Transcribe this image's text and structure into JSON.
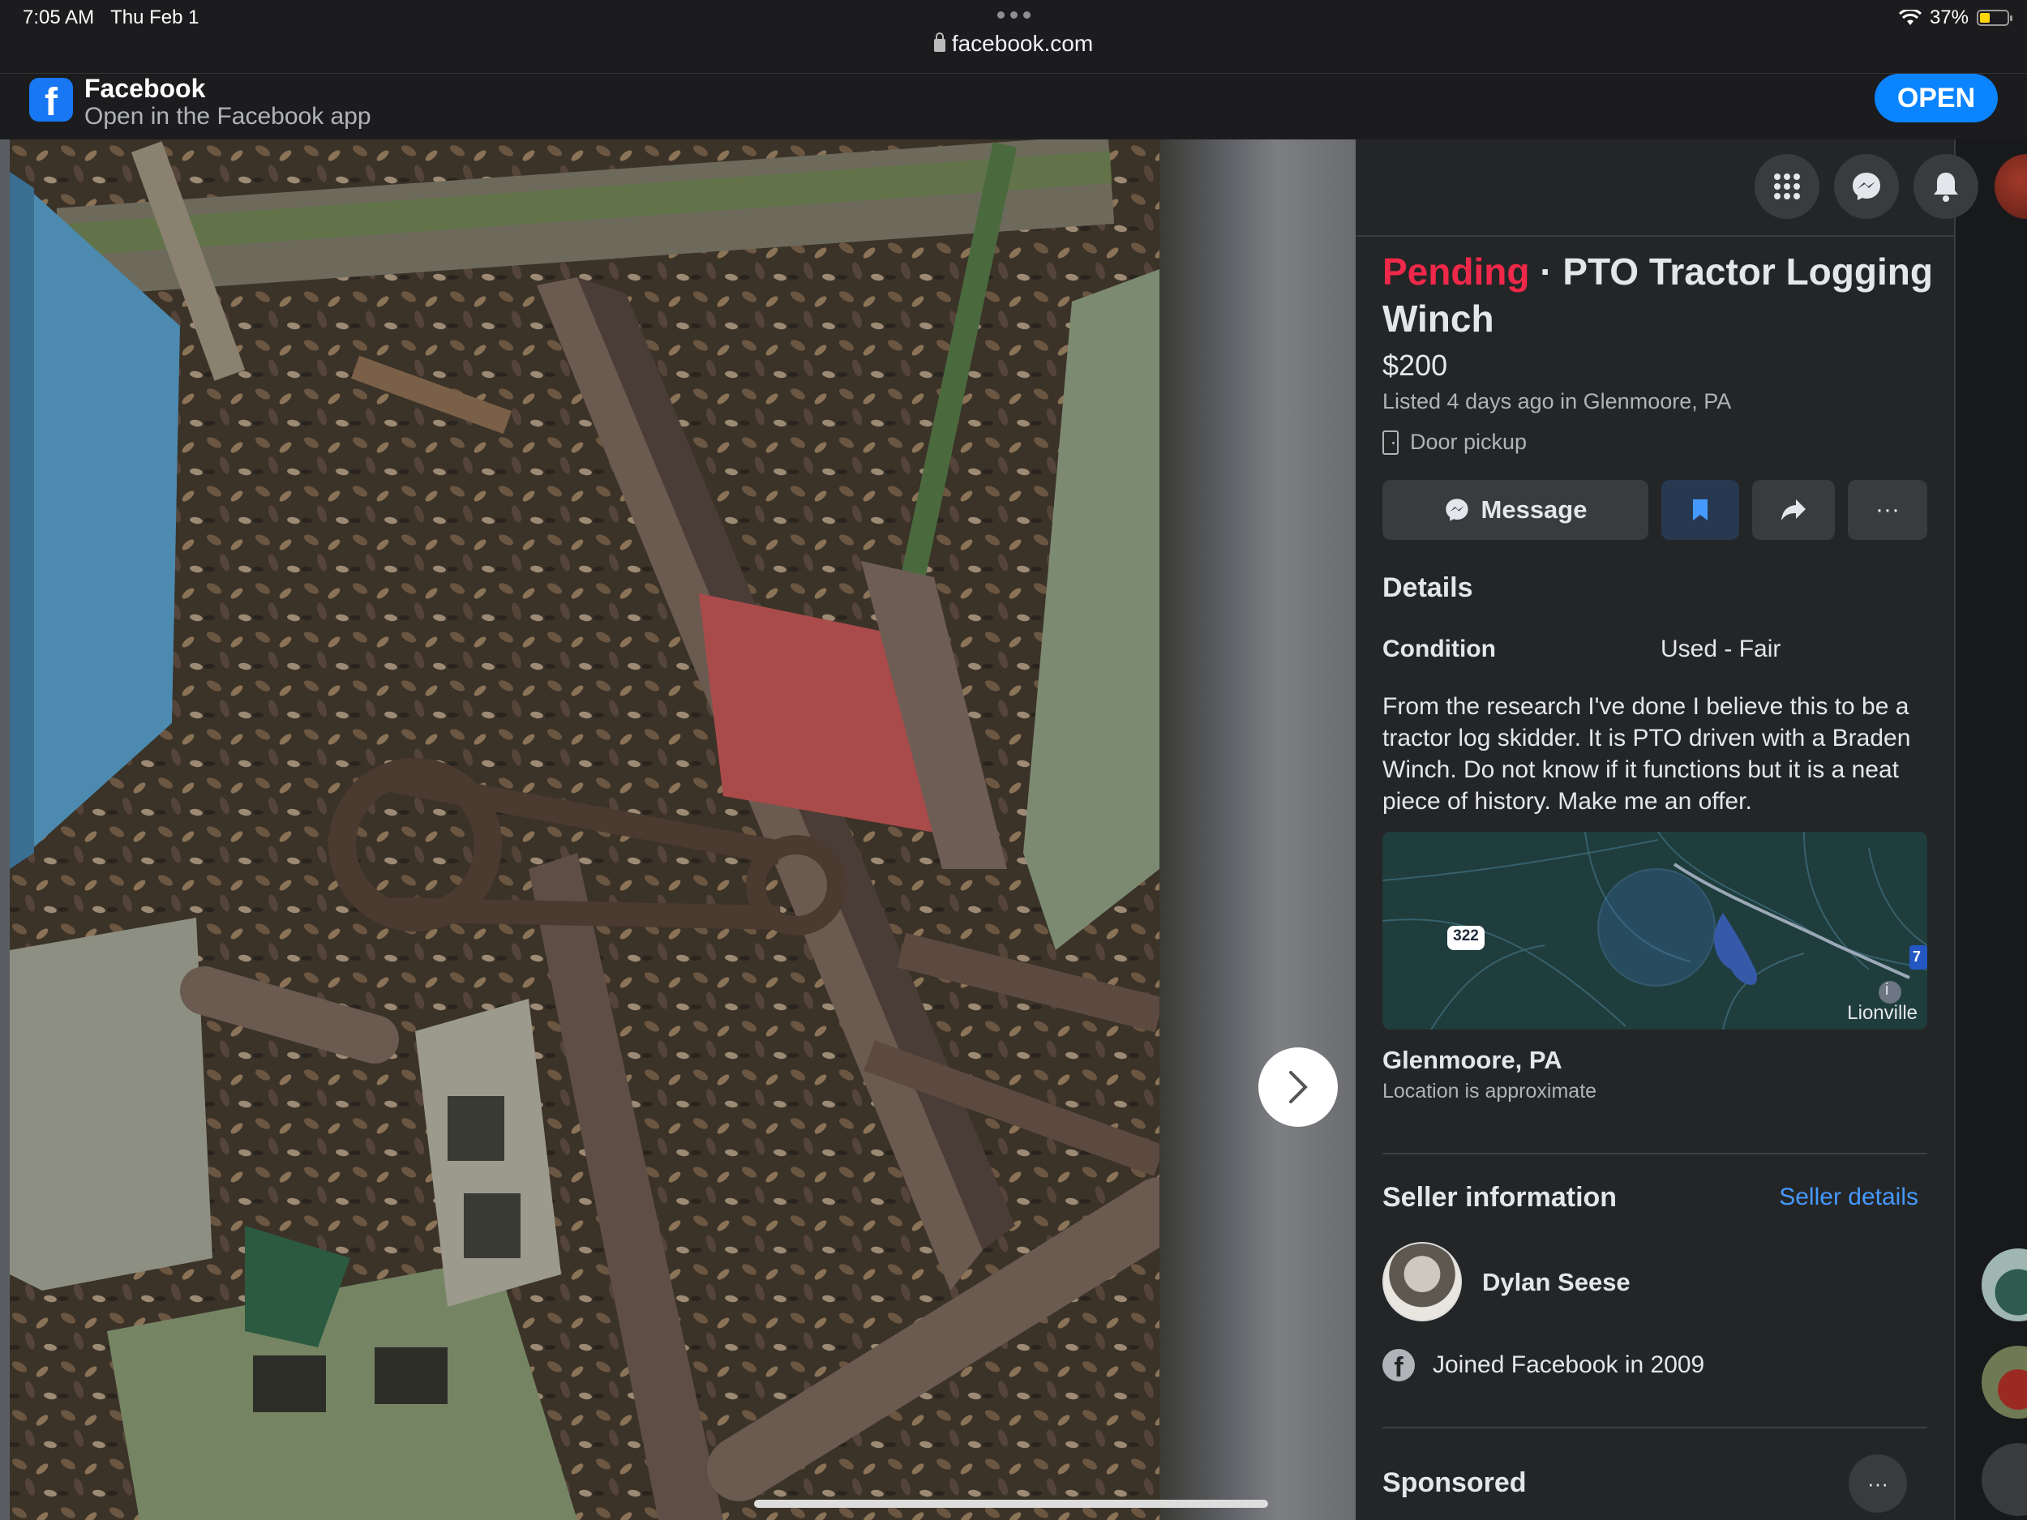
{
  "status_bar": {
    "time": "7:05 AM",
    "date": "Thu Feb 1",
    "battery": "37%",
    "battery_level": 0.37,
    "url": "facebook.com"
  },
  "app_banner": {
    "title": "Facebook",
    "subtitle": "Open in the Facebook app",
    "open_label": "OPEN"
  },
  "header_icons": [
    "menu-grid-icon",
    "messenger-icon",
    "bell-icon"
  ],
  "listing": {
    "status": "Pending",
    "separator": " · ",
    "title": "PTO Tractor Logging Winch",
    "price": "$200",
    "listed": "Listed 4 days ago in Glenmoore, PA",
    "pickup": "Door pickup",
    "message_label": "Message",
    "more_label": "···"
  },
  "details": {
    "heading": "Details",
    "condition_label": "Condition",
    "condition_value": "Used - Fair",
    "description": "From the research I've done I believe this to be a tractor log skidder. It is PTO driven with a Braden Winch. Do not know if it functions but it is a neat piece of history. Make me an offer."
  },
  "location": {
    "map_label": "Lionville",
    "route_shield": "322",
    "interstate_shield": "7",
    "name": "Glenmoore, PA",
    "note": "Location is approximate"
  },
  "seller": {
    "heading": "Seller information",
    "details_link": "Seller details",
    "name": "Dylan Seese",
    "joined": "Joined Facebook in 2009"
  },
  "sponsored": {
    "heading": "Sponsored",
    "more_label": "···"
  },
  "colors": {
    "pending": "#f02849",
    "link": "#4599ff",
    "open_button": "#0a84ff",
    "panel": "#242526",
    "save_button": "#263951"
  }
}
